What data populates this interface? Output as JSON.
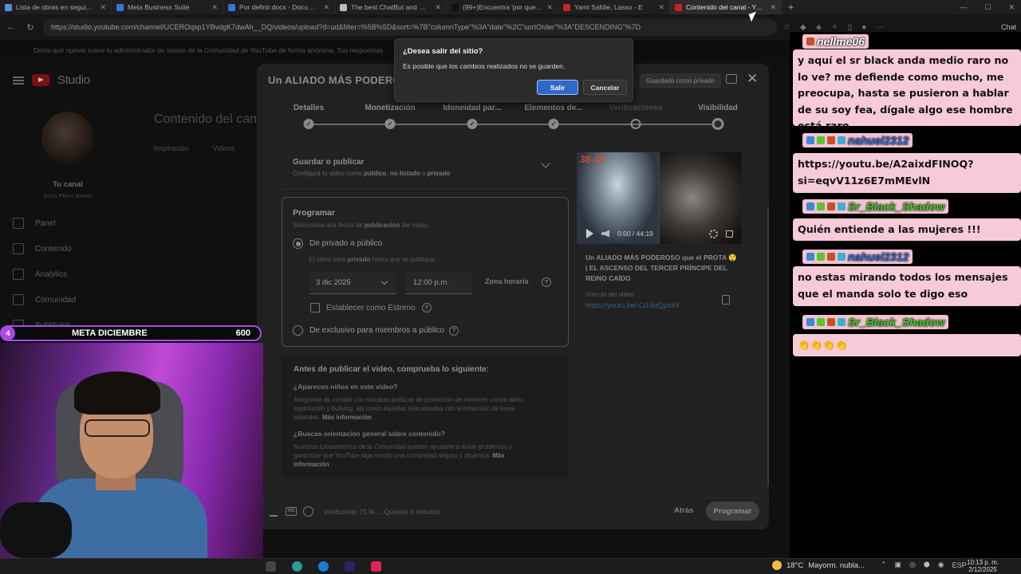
{
  "browser": {
    "tabs": [
      {
        "label": "Lista de obras en seguimien",
        "color": "#5a8ed8"
      },
      {
        "label": "Meta Business Suite",
        "color": "#3a72e0"
      },
      {
        "label": "Por definir.docx - Documen",
        "color": "#3a72e0"
      },
      {
        "label": "The best ChatBot and Widg",
        "color": "#bbbbbb"
      },
      {
        "label": "(99+)Encuentra 'por que lo",
        "color": "#111111"
      },
      {
        "label": "Yami Safdie, Lasso - E",
        "color": "#d02020"
      },
      {
        "label": "Contenido del canal - YouT",
        "color": "#d02020",
        "active": true
      }
    ],
    "new_tab": "+",
    "url": "https://studio.youtube.com/channel/UCEROqsp1YBvdgK7dwAh__DQ/videos/upload?d=ud&filter=%5B%5D&sort=%7B\"columnType\"%3A\"date\"%2C\"sortOrder\"%3A\"DESCENDING\"%7D",
    "chat_label": "Chat"
  },
  "studio": {
    "notice": "Dinos qué opinas sobre tu administrador de socios de la Comunidad de YouTube de forma anónima. Tus respuestas",
    "logo": "Studio",
    "channel_name": "Tu canal",
    "channel_sub": "Acha Pliers Nuevo",
    "nav": [
      "Panel",
      "Contenido",
      "Analytics",
      "Comunidad",
      "Subtítulos"
    ],
    "bg_title": "Contenido del canal",
    "bg_tabs": [
      "Inspiración",
      "Videos"
    ]
  },
  "modal": {
    "title": "Un ALIADO MÁS PODEROSO",
    "saved_badge": "Guardado como privado",
    "steps": [
      "Detalles",
      "Monetización",
      "Idoneidad par...",
      "Elementos de...",
      "Verificaciones",
      "Visibilidad"
    ],
    "guardar": {
      "title": "Guardar o publicar",
      "sub_prefix": "Configura tu video como ",
      "sub_public": "público",
      "sub_comma": ", ",
      "sub_unlisted": "no listado",
      "sub_or": " o ",
      "sub_private": "privado"
    },
    "programar": {
      "title": "Programar",
      "sub_prefix": "Selecciona una fecha de ",
      "sub_bold": "publicación",
      "sub_suffix": " del video.",
      "option1": "De privado a público",
      "option1_note_prefix": "El video será ",
      "option1_note_bold": "privado",
      "option1_note_suffix": " hasta que se publique.",
      "date": "3 dic 2025",
      "time": "12:00 p.m.",
      "timezone": "Zona horaria",
      "premiere": "Establecer como Estreno",
      "option2": "De exclusivo para miembros a público"
    },
    "checklist": {
      "title": "Antes de publicar el video, comprueba lo siguiente:",
      "q1": "¿Aparecen niños en este video?",
      "a1": "Asegúrate de cumplir con nuestras políticas de protección de menores contra daño, explotación y bullying, así como aquellas relacionadas con la infracción de leyes laborales.",
      "q2": "¿Buscas orientación general sobre contenido?",
      "a2": "Nuestros Lineamientos de la Comunidad pueden ayudarte a evitar problemas y garantizar que YouTube siga siendo una comunidad segura y dinámica.",
      "more": "Más información"
    },
    "video": {
      "thumb_number": "38-45",
      "time": "0:00 / 44:19",
      "title": "Un ALIADO MÁS PODEROSO que el PROTA 😲 | EL ASCENSO DEL TERCER PRÍNCIPE DEL REINO CAÍDO",
      "link_label": "Vínculo del video",
      "link": "https://youtu.be/-OJ-bzQps9Y"
    },
    "footer": {
      "hd": "HD",
      "status": "Verificando 71 % ... Quedan 6 minutos",
      "back": "Atrás",
      "schedule": "Programar"
    }
  },
  "dialog": {
    "title": "¿Desea salir del sitio?",
    "message": "Es posible que los cambios realizados no se guarden.",
    "exit": "Salir",
    "cancel": "Cancelar"
  },
  "chat": [
    {
      "user": "nellme06",
      "name_color": "#ffffff",
      "msg": "y aquí el sr black anda medio raro no lo ve? me defiende como mucho, me preocupa, hasta se pusieron a hablar de su soy fea, dígale algo ese hombre está raro"
    },
    {
      "user": "nahuel2312",
      "name_color": "#3b6fd6",
      "msg": "https://youtu.be/A2aixdFINOQ?si=eqvV11z6E7mMEvlN"
    },
    {
      "user": "Sr_Black_Shadow",
      "name_color": "#46c926",
      "msg": "Quién entiende a las mujeres !!!"
    },
    {
      "user": "nahuel2312",
      "name_color": "#3b6fd6",
      "msg": "no estas mirando todos los mensajes que el manda solo te digo eso"
    },
    {
      "user": "Sr_Black_Shadow",
      "name_color": "#46c926",
      "msg": "👏👏👏👏"
    }
  ],
  "meta": {
    "number": "4",
    "label": "META DICIEMBRE",
    "value": "600"
  },
  "taskbar": {
    "temp": "18°C",
    "weather": "Mayorm. nubla...",
    "lang": "ESP",
    "time": "10:13 p. m.",
    "date": "2/12/2025"
  }
}
